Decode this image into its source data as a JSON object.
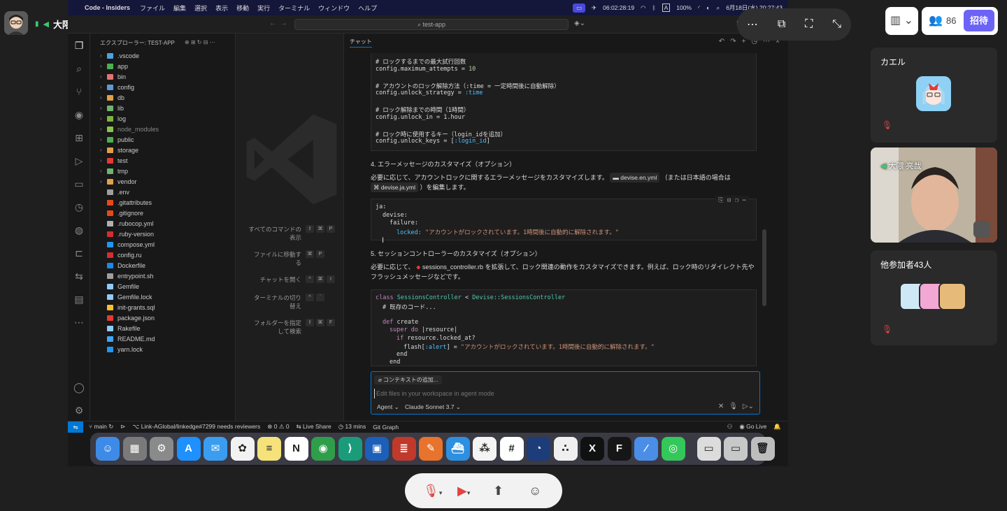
{
  "meeting": {
    "presenter_label": "大隈 亮哉の画面",
    "participant_count": "86",
    "invite_label": "招待",
    "participants": [
      {
        "name": "カエル"
      },
      {
        "name": "大隈 亮哉"
      }
    ],
    "others_label": "他参加者43人"
  },
  "mac_menubar": {
    "app": "Code - Insiders",
    "items": [
      "ファイル",
      "編集",
      "選択",
      "表示",
      "移動",
      "実行",
      "ターミナル",
      "ウィンドウ",
      "ヘルプ"
    ],
    "timer": "06:02:28:19",
    "battery": "100%",
    "datetime": "6月18日(水) 20:27:43",
    "input_mode": "A"
  },
  "vscode": {
    "search_text": "test-app",
    "explorer_title": "エクスプローラー: TEST-APP",
    "folders": [
      {
        "name": ".vscode",
        "color": "#4aa3df"
      },
      {
        "name": "app",
        "color": "#4caf50"
      },
      {
        "name": "bin",
        "color": "#e57373"
      },
      {
        "name": "config",
        "color": "#5c9bd6"
      },
      {
        "name": "db",
        "color": "#e0a04a"
      },
      {
        "name": "lib",
        "color": "#6fb36f"
      },
      {
        "name": "log",
        "color": "#7cb342"
      },
      {
        "name": "node_modules",
        "color": "#8bc34a"
      },
      {
        "name": "public",
        "color": "#4caf50"
      },
      {
        "name": "storage",
        "color": "#e0a04a"
      },
      {
        "name": "test",
        "color": "#e53935"
      },
      {
        "name": "tmp",
        "color": "#6fb36f"
      },
      {
        "name": "vendor",
        "color": "#e0a04a"
      }
    ],
    "files": [
      {
        "name": ".env",
        "color": "#9e9e9e"
      },
      {
        "name": ".gitattributes",
        "color": "#e64a19"
      },
      {
        "name": ".gitignore",
        "color": "#e64a19"
      },
      {
        "name": ".rubocop.yml",
        "color": "#b0b0b0"
      },
      {
        "name": ".ruby-version",
        "color": "#d32f2f"
      },
      {
        "name": "compose.yml",
        "color": "#2196f3"
      },
      {
        "name": "config.ru",
        "color": "#d32f2f"
      },
      {
        "name": "Dockerfile",
        "color": "#1e88e5"
      },
      {
        "name": "entrypoint.sh",
        "color": "#9e9e9e"
      },
      {
        "name": "Gemfile",
        "color": "#90caf9"
      },
      {
        "name": "Gemfile.lock",
        "color": "#90caf9"
      },
      {
        "name": "init-grants.sql",
        "color": "#fbc02d"
      },
      {
        "name": "package.json",
        "color": "#e53935"
      },
      {
        "name": "Rakefile",
        "color": "#90caf9"
      },
      {
        "name": "README.md",
        "color": "#42a5f5"
      },
      {
        "name": "yarn.lock",
        "color": "#2196f3"
      }
    ],
    "shortcuts": [
      {
        "label": "すべてのコマンドの表示",
        "keys": [
          "⇧",
          "⌘",
          "P"
        ]
      },
      {
        "label": "ファイルに移動する",
        "keys": [
          "⌘",
          "P"
        ]
      },
      {
        "label": "チャットを開く",
        "keys": [
          "^",
          "⌘",
          "I"
        ]
      },
      {
        "label": "ターミナルの切り替え",
        "keys": [
          "^",
          "`"
        ]
      },
      {
        "label": "フォルダーを指定して検索",
        "keys": [
          "⇧",
          "⌘",
          "F"
        ]
      }
    ],
    "chat_tab": "チャット",
    "code1": {
      "c1": "# ロックするまでの最大試行回数",
      "l1a": "config.maximum_attempts = ",
      "l1b": "10",
      "c2": "# アカウントのロック解除方法（:time = 一定時間後に自動解除）",
      "l2a": "config.unlock_strategy = ",
      "l2b": ":time",
      "c3": "# ロック解除までの時間（1時間）",
      "l3": "config.unlock_in = 1.hour",
      "c4": "# ロック時に使用するキー（login_idを追加）",
      "l4a": "config.unlock_keys = [",
      "l4b": ":login_id",
      "l4c": "]"
    },
    "section4_title": "4. エラーメッセージのカスタマイズ（オプション）",
    "section4_text_a": "必要に応じて、アカウントロックに関するエラーメッセージをカスタマイズします。",
    "section4_chip1": "devise.en.yml",
    "section4_text_b": "（または日本語の場合は",
    "section4_chip2": "devise.ja.yml",
    "section4_text_c": "）を編集します。",
    "yaml": {
      "l1": "ja:",
      "l2": "devise:",
      "l3": "failure:",
      "l4a": "locked: ",
      "l4b": "\"アカウントがロックされています。1時間後に自動的に解除されます。\""
    },
    "section5_title": "5. セッションコントローラーのカスタマイズ（オプション）",
    "section5_text_a": "必要に応じて、",
    "section5_chip": "sessions_controller.rb",
    "section5_text_b": "を拡張して、ロック関連の動作をカスタマイズできます。例えば、ロック時のリダイレクト先や",
    "section5_text_c": "フラッシュメッセージなどです。",
    "code2": {
      "l1a": "class ",
      "l1b": "SessionsController",
      "l1c": " < ",
      "l1d": "Devise::SessionsController",
      "l2": "# 既存のコード...",
      "l3a": "def ",
      "l3b": "create",
      "l4a": "super do ",
      "l4b": "|resource|",
      "l5a": "if ",
      "l5b": "resource.locked_at?",
      "l6a": "flash[",
      "l6b": ":alert",
      "l6c": "] = ",
      "l6d": "\"アカウントがロックされています。1時間後に自動的に解除されます。\"",
      "l7": "end",
      "l8": "end"
    },
    "context_button": "コンテキストの追加...",
    "input_placeholder": "Edit files in your workspace in agent mode",
    "mode": "Agent",
    "model": "Claude Sonnet 3.7",
    "status": {
      "branch": "main",
      "pr": "Link-AGlobal/linkedge#7299 needs reviewers",
      "errors": "0",
      "warnings": "0",
      "live_share": "Live Share",
      "time": "13 mins",
      "git_graph": "Git Graph",
      "go_live": "Go Live"
    }
  },
  "dock": [
    {
      "name": "finder",
      "color": "#3d8be6",
      "glyph": "☺"
    },
    {
      "name": "launchpad",
      "color": "#7a7a7a",
      "glyph": "▦"
    },
    {
      "name": "system-settings",
      "color": "#8a8a8a",
      "glyph": "⚙"
    },
    {
      "name": "app-store",
      "color": "#1e90ff",
      "glyph": "A"
    },
    {
      "name": "mail",
      "color": "#3a9df0",
      "glyph": "✉"
    },
    {
      "name": "photos",
      "color": "#f2f2f2",
      "glyph": "✿"
    },
    {
      "name": "notes",
      "color": "#f5e27a",
      "glyph": "≡"
    },
    {
      "name": "notion",
      "color": "#ffffff",
      "glyph": "N"
    },
    {
      "name": "chrome",
      "color": "#2e9e4a",
      "glyph": "◉"
    },
    {
      "name": "vscode-insiders",
      "color": "#1a9c7a",
      "glyph": "⟩"
    },
    {
      "name": "trello",
      "color": "#1c5fb8",
      "glyph": "▣"
    },
    {
      "name": "database",
      "color": "#c0392b",
      "glyph": "≣"
    },
    {
      "name": "tool",
      "color": "#e8732c",
      "glyph": "✎"
    },
    {
      "name": "docker",
      "color": "#2d8fe0",
      "glyph": "⛴"
    },
    {
      "name": "dots-app",
      "color": "#f4f4f4",
      "glyph": "⁂"
    },
    {
      "name": "slack",
      "color": "#ffffff",
      "glyph": "#"
    },
    {
      "name": "timer",
      "color": "#1c3c7a",
      "glyph": "◔"
    },
    {
      "name": "asana",
      "color": "#f0f0f0",
      "glyph": "∴"
    },
    {
      "name": "x",
      "color": "#111111",
      "glyph": "X"
    },
    {
      "name": "framer",
      "color": "#161616",
      "glyph": "F"
    },
    {
      "name": "pen",
      "color": "#4a8ee8",
      "glyph": "⁄"
    },
    {
      "name": "chatgpt",
      "color": "#34c759",
      "glyph": "◎"
    },
    {
      "name": "preview",
      "color": "#dcdcdc",
      "glyph": "▭"
    },
    {
      "name": "browser",
      "color": "#c8c8c8",
      "glyph": "▭"
    },
    {
      "name": "trash",
      "color": "#bdbdbd",
      "glyph": "🗑"
    }
  ],
  "colors": {
    "accent": "#0078d4",
    "invite": "#6b63f5"
  }
}
